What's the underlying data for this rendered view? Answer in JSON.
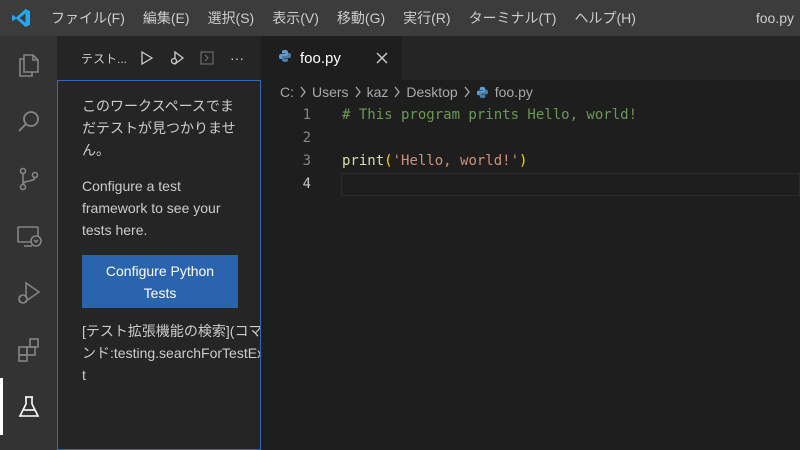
{
  "menu": [
    "ファイル(F)",
    "編集(E)",
    "選択(S)",
    "表示(V)",
    "移動(G)",
    "実行(R)",
    "ターミナル(T)",
    "ヘルプ(H)"
  ],
  "window_title": "foo.py",
  "activity_icons": [
    "explorer-icon",
    "search-icon",
    "source-control-icon",
    "remote-explorer-icon",
    "run-debug-icon",
    "extensions-icon",
    "testing-icon"
  ],
  "sidebar": {
    "title": "テスト...",
    "more": "···",
    "message_jp": "このワークスペースでまだテストが見つかりません。",
    "message_en": "Configure a test framework to see your tests here.",
    "button_label": "Configure Python Tests",
    "command_text": "[テスト拡張機能の検索](コマンド:testing.searchForTestExt"
  },
  "tab": {
    "label": "foo.py",
    "close": "✕"
  },
  "breadcrumb": [
    "C:",
    "Users",
    "kaz",
    "Desktop",
    "foo.py"
  ],
  "code": {
    "line_numbers": [
      "1",
      "2",
      "3",
      "4"
    ],
    "line1": "# This program prints Hello, world!",
    "line3_fn": "print",
    "line3_open": "(",
    "line3_str": "'Hello, world!'",
    "line3_close": ")"
  },
  "colors": {
    "accent": "#2a64ad",
    "focus_border": "#2f69b8",
    "logo": "#23a9f2"
  }
}
